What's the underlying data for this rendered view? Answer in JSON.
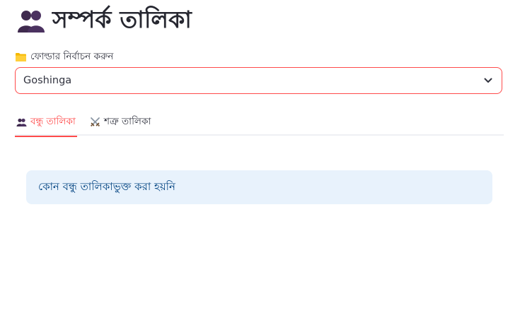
{
  "header": {
    "icon": "people-icon",
    "title": "সম্পর্ক তালিকা"
  },
  "folder_select": {
    "icon": "folder-icon",
    "label": "ফোল্ডার নির্বাচন করুন",
    "value": "Goshinga"
  },
  "tabs": [
    {
      "icon": "people-icon",
      "label": "বন্ধু তালিকা",
      "active": true
    },
    {
      "icon": "crossed-swords-icon",
      "label": "শত্রু তালিকা",
      "active": false
    }
  ],
  "info": {
    "message": "কোন বন্ধু তালিকাভুক্ত করা হয়নি"
  },
  "colors": {
    "accent": "#ff4b4b",
    "info_bg": "#e8f2fc",
    "info_text": "#004280",
    "people_icon": "#3f2a4e"
  }
}
